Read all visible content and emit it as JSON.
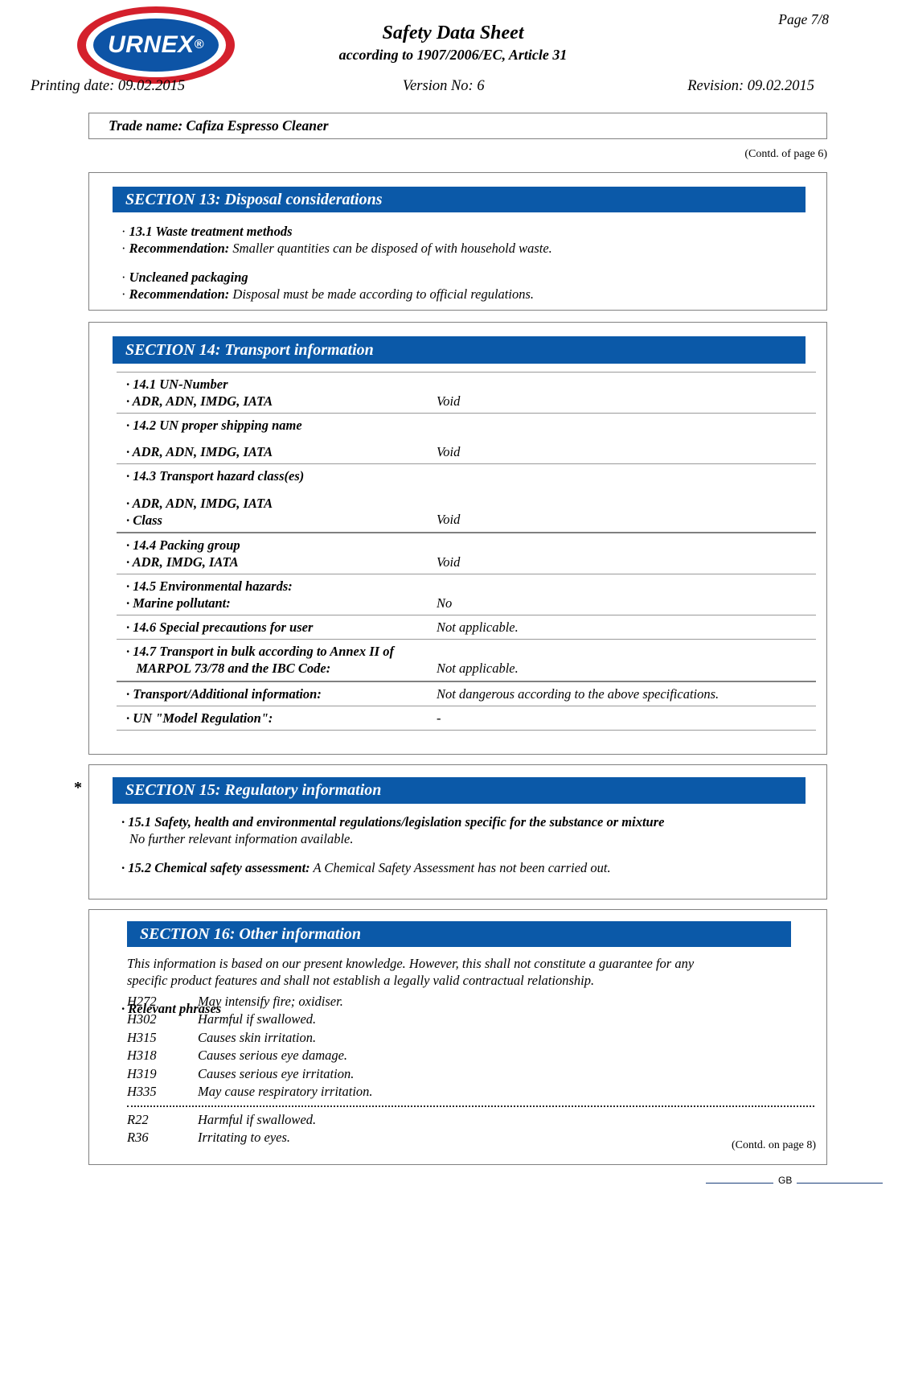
{
  "header": {
    "logo_text": "URNEX",
    "logo_reg": "®",
    "page_indicator": "Page 7/8",
    "title": "Safety Data Sheet",
    "subtitle": "according to 1907/2006/EC, Article 31",
    "printing_date": "Printing date: 09.02.2015",
    "version": "Version No: 6",
    "revision": "Revision: 09.02.2015"
  },
  "trade_name": "Trade name: Cafiza Espresso Cleaner",
  "contd_of_page": "(Contd. of page 6)",
  "contd_on_page": "(Contd. on page 8)",
  "footer_lang": "GB",
  "section13": {
    "heading": "SECTION 13: Disposal considerations",
    "lines": [
      {
        "bullet": "·",
        "bold": "13.1 Waste treatment methods",
        "rest": ""
      },
      {
        "bullet": "·",
        "bold": "Recommendation:",
        "rest": " Smaller quantities can be disposed of with household waste."
      },
      {
        "bullet": "·",
        "bold": "Uncleaned packaging",
        "rest": ""
      },
      {
        "bullet": "·",
        "bold": "Recommendation:",
        "rest": " Disposal must be made according to official regulations."
      }
    ]
  },
  "section14": {
    "heading": "SECTION 14: Transport information",
    "rows": [
      {
        "label_lines": [
          "· 14.1 UN-Number",
          "· ADR, ADN, IMDG, IATA"
        ],
        "value": "Void",
        "value_align": "bottom"
      },
      {
        "label_lines": [
          "· 14.2 UN proper shipping name",
          "",
          "· ADR, ADN, IMDG, IATA"
        ],
        "value": "Void",
        "value_align": "bottom"
      },
      {
        "label_lines": [
          "· 14.3 Transport hazard class(es)",
          "",
          "· ADR, ADN, IMDG, IATA",
          "· Class"
        ],
        "value": "Void",
        "value_align": "bottom"
      },
      {
        "label_lines": [
          "· 14.4 Packing group",
          "· ADR, IMDG, IATA"
        ],
        "value": "Void",
        "value_align": "bottom"
      },
      {
        "label_lines": [
          "· 14.5 Environmental hazards:",
          "· Marine pollutant:"
        ],
        "value": "No",
        "value_align": "bottom"
      },
      {
        "label_lines": [
          "· 14.6 Special precautions for user"
        ],
        "value": "Not applicable.",
        "value_align": "top"
      },
      {
        "label_lines": [
          "· 14.7 Transport in bulk according to Annex II of",
          "   MARPOL 73/78 and the IBC Code:"
        ],
        "value": "Not applicable.",
        "value_align": "bottom"
      },
      {
        "label_lines": [
          "· Transport/Additional information:"
        ],
        "value": "Not dangerous according to the above specifications.",
        "value_align": "top"
      },
      {
        "label_lines": [
          "· UN \"Model Regulation\":"
        ],
        "value": "-",
        "value_align": "top"
      }
    ]
  },
  "section15": {
    "asterisk": "*",
    "heading": "SECTION 15: Regulatory information",
    "item1_bold": "· 15.1 Safety, health and environmental regulations/legislation specific for the substance or mixture",
    "item1_text": "No further relevant information available.",
    "item2_bold": "· 15.2 Chemical safety assessment:",
    "item2_text": " A Chemical Safety Assessment has not been carried out."
  },
  "section16": {
    "heading": "SECTION 16: Other information",
    "disclaimer_line1": "This information is based on our present knowledge. However, this shall not constitute a guarantee for any",
    "disclaimer_line2": "specific product features and shall not establish a legally valid contractual relationship.",
    "relevant_phrases_label": "· Relevant phrases",
    "h_phrases": [
      {
        "code": "H272",
        "text": "May intensify fire; oxidiser."
      },
      {
        "code": "H302",
        "text": "Harmful if swallowed."
      },
      {
        "code": "H315",
        "text": "Causes skin irritation."
      },
      {
        "code": "H318",
        "text": "Causes serious eye damage."
      },
      {
        "code": "H319",
        "text": "Causes serious eye irritation."
      },
      {
        "code": "H335",
        "text": "May cause respiratory irritation."
      }
    ],
    "r_phrases": [
      {
        "code": "R22",
        "text": "Harmful if swallowed."
      },
      {
        "code": "R36",
        "text": "Irritating to eyes."
      }
    ]
  },
  "colors": {
    "section_bar": "#0b59a8",
    "logo_red": "#d4202c",
    "logo_blue": "#0d54a6",
    "border_gray": "#808080"
  }
}
